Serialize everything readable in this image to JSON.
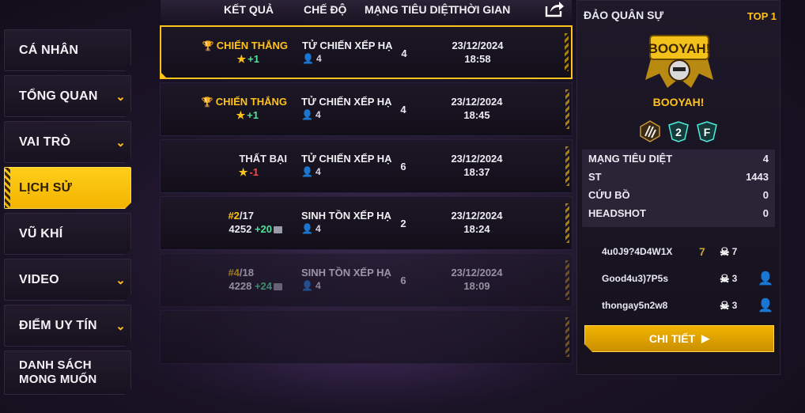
{
  "sidebar": {
    "items": [
      {
        "label": "CÁ NHÂN"
      },
      {
        "label": "TỔNG QUAN"
      },
      {
        "label": "VAI TRÒ"
      },
      {
        "label": "LỊCH SỬ"
      },
      {
        "label": "VŨ KHÍ"
      },
      {
        "label": "VIDEO"
      },
      {
        "label": "ĐIỂM UY TÍN"
      },
      {
        "label_line1": "DANH SÁCH",
        "label_line2": "MONG MUỐN"
      }
    ]
  },
  "header": {
    "result": "KẾT QUẢ",
    "mode": "CHẾ ĐỘ",
    "kills": "MẠNG TIÊU DIỆT",
    "time": "THỜI GIAN"
  },
  "matches": [
    {
      "result": "CHIẾN THẮNG",
      "change": "+1",
      "mode": "TỬ CHIẾN XẾP HẠ",
      "squad": "4",
      "kills": "4",
      "date": "23/12/2024",
      "time": "18:58"
    },
    {
      "result": "CHIẾN THẮNG",
      "change": "+1",
      "mode": "TỬ CHIẾN XẾP HẠ",
      "squad": "4",
      "kills": "4",
      "date": "23/12/2024",
      "time": "18:45"
    },
    {
      "result": "THẤT BẠI",
      "change": "-1",
      "mode": "TỬ CHIẾN XẾP HẠ",
      "squad": "4",
      "kills": "6",
      "date": "23/12/2024",
      "time": "18:37"
    },
    {
      "rank": "#2",
      "total": "/17",
      "points": "4252",
      "gain": "+20",
      "mode": "SINH TỒN XẾP HẠ",
      "squad": "4",
      "kills": "2",
      "date": "23/12/2024",
      "time": "18:24"
    },
    {
      "rank": "#4",
      "total": "/18",
      "points": "4228",
      "gain": "+24",
      "mode": "SINH TỒN XẾP HẠ",
      "squad": "4",
      "kills": "6",
      "date": "23/12/2024",
      "time": "18:09"
    }
  ],
  "detail": {
    "map": "ĐẢO QUÂN SỰ",
    "rank": "TOP 1",
    "badge_text": "BOOYAH!",
    "result": "BOOYAH!",
    "badge_2": "2",
    "badge_f": "F",
    "stats": [
      {
        "label": "MẠNG TIÊU DIỆT",
        "value": "4"
      },
      {
        "label": "ST",
        "value": "1443"
      },
      {
        "label": "CỨU BỒ",
        "value": "0"
      },
      {
        "label": "HEADSHOT",
        "value": "0"
      }
    ],
    "players": [
      {
        "name": "4u0J9?4D4W1X",
        "badge": "7",
        "kills": "7"
      },
      {
        "name": "Good4u3)7P5s",
        "kills": "3"
      },
      {
        "name": "thongay5n2w8",
        "kills": "3"
      }
    ],
    "button": "CHI TIẾT"
  }
}
